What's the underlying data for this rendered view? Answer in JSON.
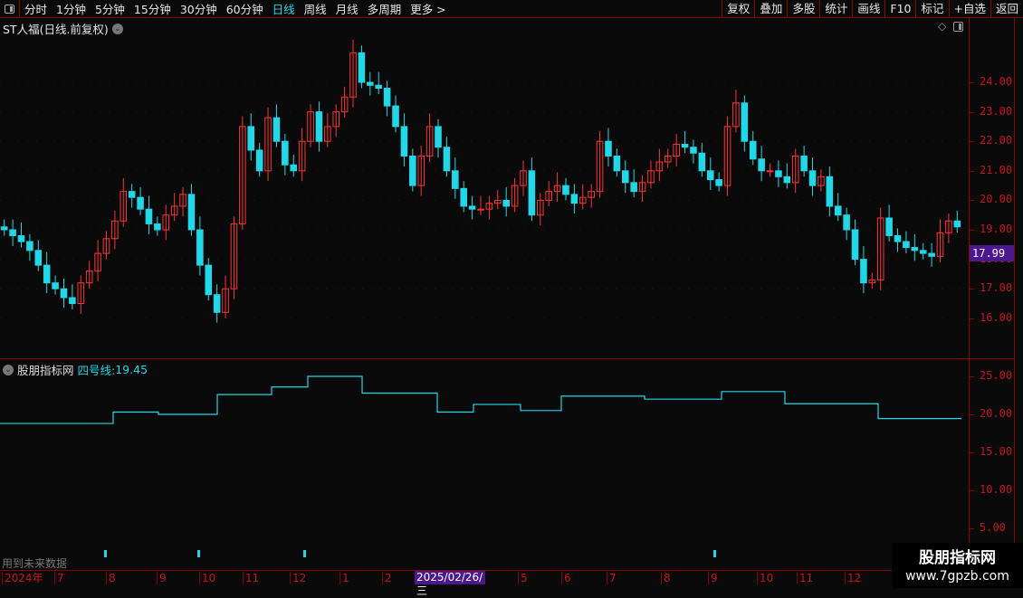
{
  "toolbar": {
    "periods": [
      "分时",
      "1分钟",
      "5分钟",
      "15分钟",
      "30分钟",
      "60分钟",
      "日线",
      "周线",
      "月线",
      "多周期",
      "更多 >"
    ],
    "active_period": "日线",
    "right_buttons": [
      "复权",
      "叠加",
      "多股",
      "统计",
      "画线",
      "F10",
      "标记",
      "+自选",
      "返回"
    ]
  },
  "chart": {
    "title": "ST人福(日线.前复权)",
    "current_price": "17.99",
    "y_labels": [
      "24.00",
      "23.00",
      "22.00",
      "21.00",
      "20.00",
      "19.00",
      "18.00",
      "17.00",
      "16.00"
    ],
    "up_color": "#ff3333",
    "down_color": "#21d7e8",
    "closes": [
      19.0,
      18.8,
      18.6,
      18.3,
      17.8,
      17.2,
      17.0,
      16.7,
      16.5,
      17.2,
      17.6,
      18.2,
      18.7,
      19.3,
      20.3,
      20.1,
      19.7,
      19.2,
      19.0,
      19.5,
      19.8,
      20.2,
      19.0,
      17.8,
      16.8,
      16.2,
      17.0,
      19.2,
      22.5,
      21.7,
      21.0,
      22.8,
      22.0,
      21.2,
      21.0,
      22.0,
      23.0,
      22.0,
      22.5,
      23.0,
      23.5,
      25.0,
      24.0,
      23.9,
      23.8,
      23.2,
      22.5,
      21.5,
      20.5,
      21.5,
      22.5,
      21.8,
      21.0,
      20.4,
      19.8,
      19.7,
      19.7,
      19.9,
      20.0,
      19.8,
      20.5,
      21.0,
      19.5,
      20.0,
      20.3,
      20.5,
      20.2,
      19.9,
      20.1,
      20.3,
      22.0,
      21.5,
      21.0,
      20.6,
      20.3,
      20.6,
      21.0,
      21.3,
      21.5,
      21.9,
      21.8,
      21.6,
      21.0,
      20.7,
      20.5,
      22.5,
      23.3,
      22.0,
      21.4,
      21.0,
      21.0,
      20.8,
      20.6,
      21.5,
      21.0,
      20.5,
      20.8,
      19.8,
      19.5,
      19.0,
      18.0,
      17.2,
      17.3,
      19.4,
      18.8,
      18.6,
      18.4,
      18.3,
      18.2,
      18.1,
      18.9,
      19.3,
      19.1
    ]
  },
  "indicator": {
    "name": "股朋指标网",
    "line_label": "四号线:",
    "line_value": "19.45",
    "line_color": "#21d7e8",
    "y_labels": [
      "25.00",
      "20.00",
      "15.00",
      "10.00",
      "5.00"
    ],
    "steps": [
      18.8,
      20.3,
      20.0,
      22.6,
      23.6,
      25.0,
      22.8,
      20.3,
      21.3,
      20.5,
      22.4,
      22.0,
      23.0,
      21.4,
      19.45
    ],
    "note": "用到未来数据"
  },
  "time_axis": {
    "labels": [
      "2024年",
      "7",
      "8",
      "9",
      "10",
      "11",
      "12",
      "1",
      "2",
      "5",
      "6",
      "7",
      "8",
      "9",
      "10",
      "11",
      "12"
    ],
    "highlight": "2025/02/26/三"
  },
  "watermark": {
    "name": "股朋指标网",
    "url": "www.7gpzb.com"
  }
}
